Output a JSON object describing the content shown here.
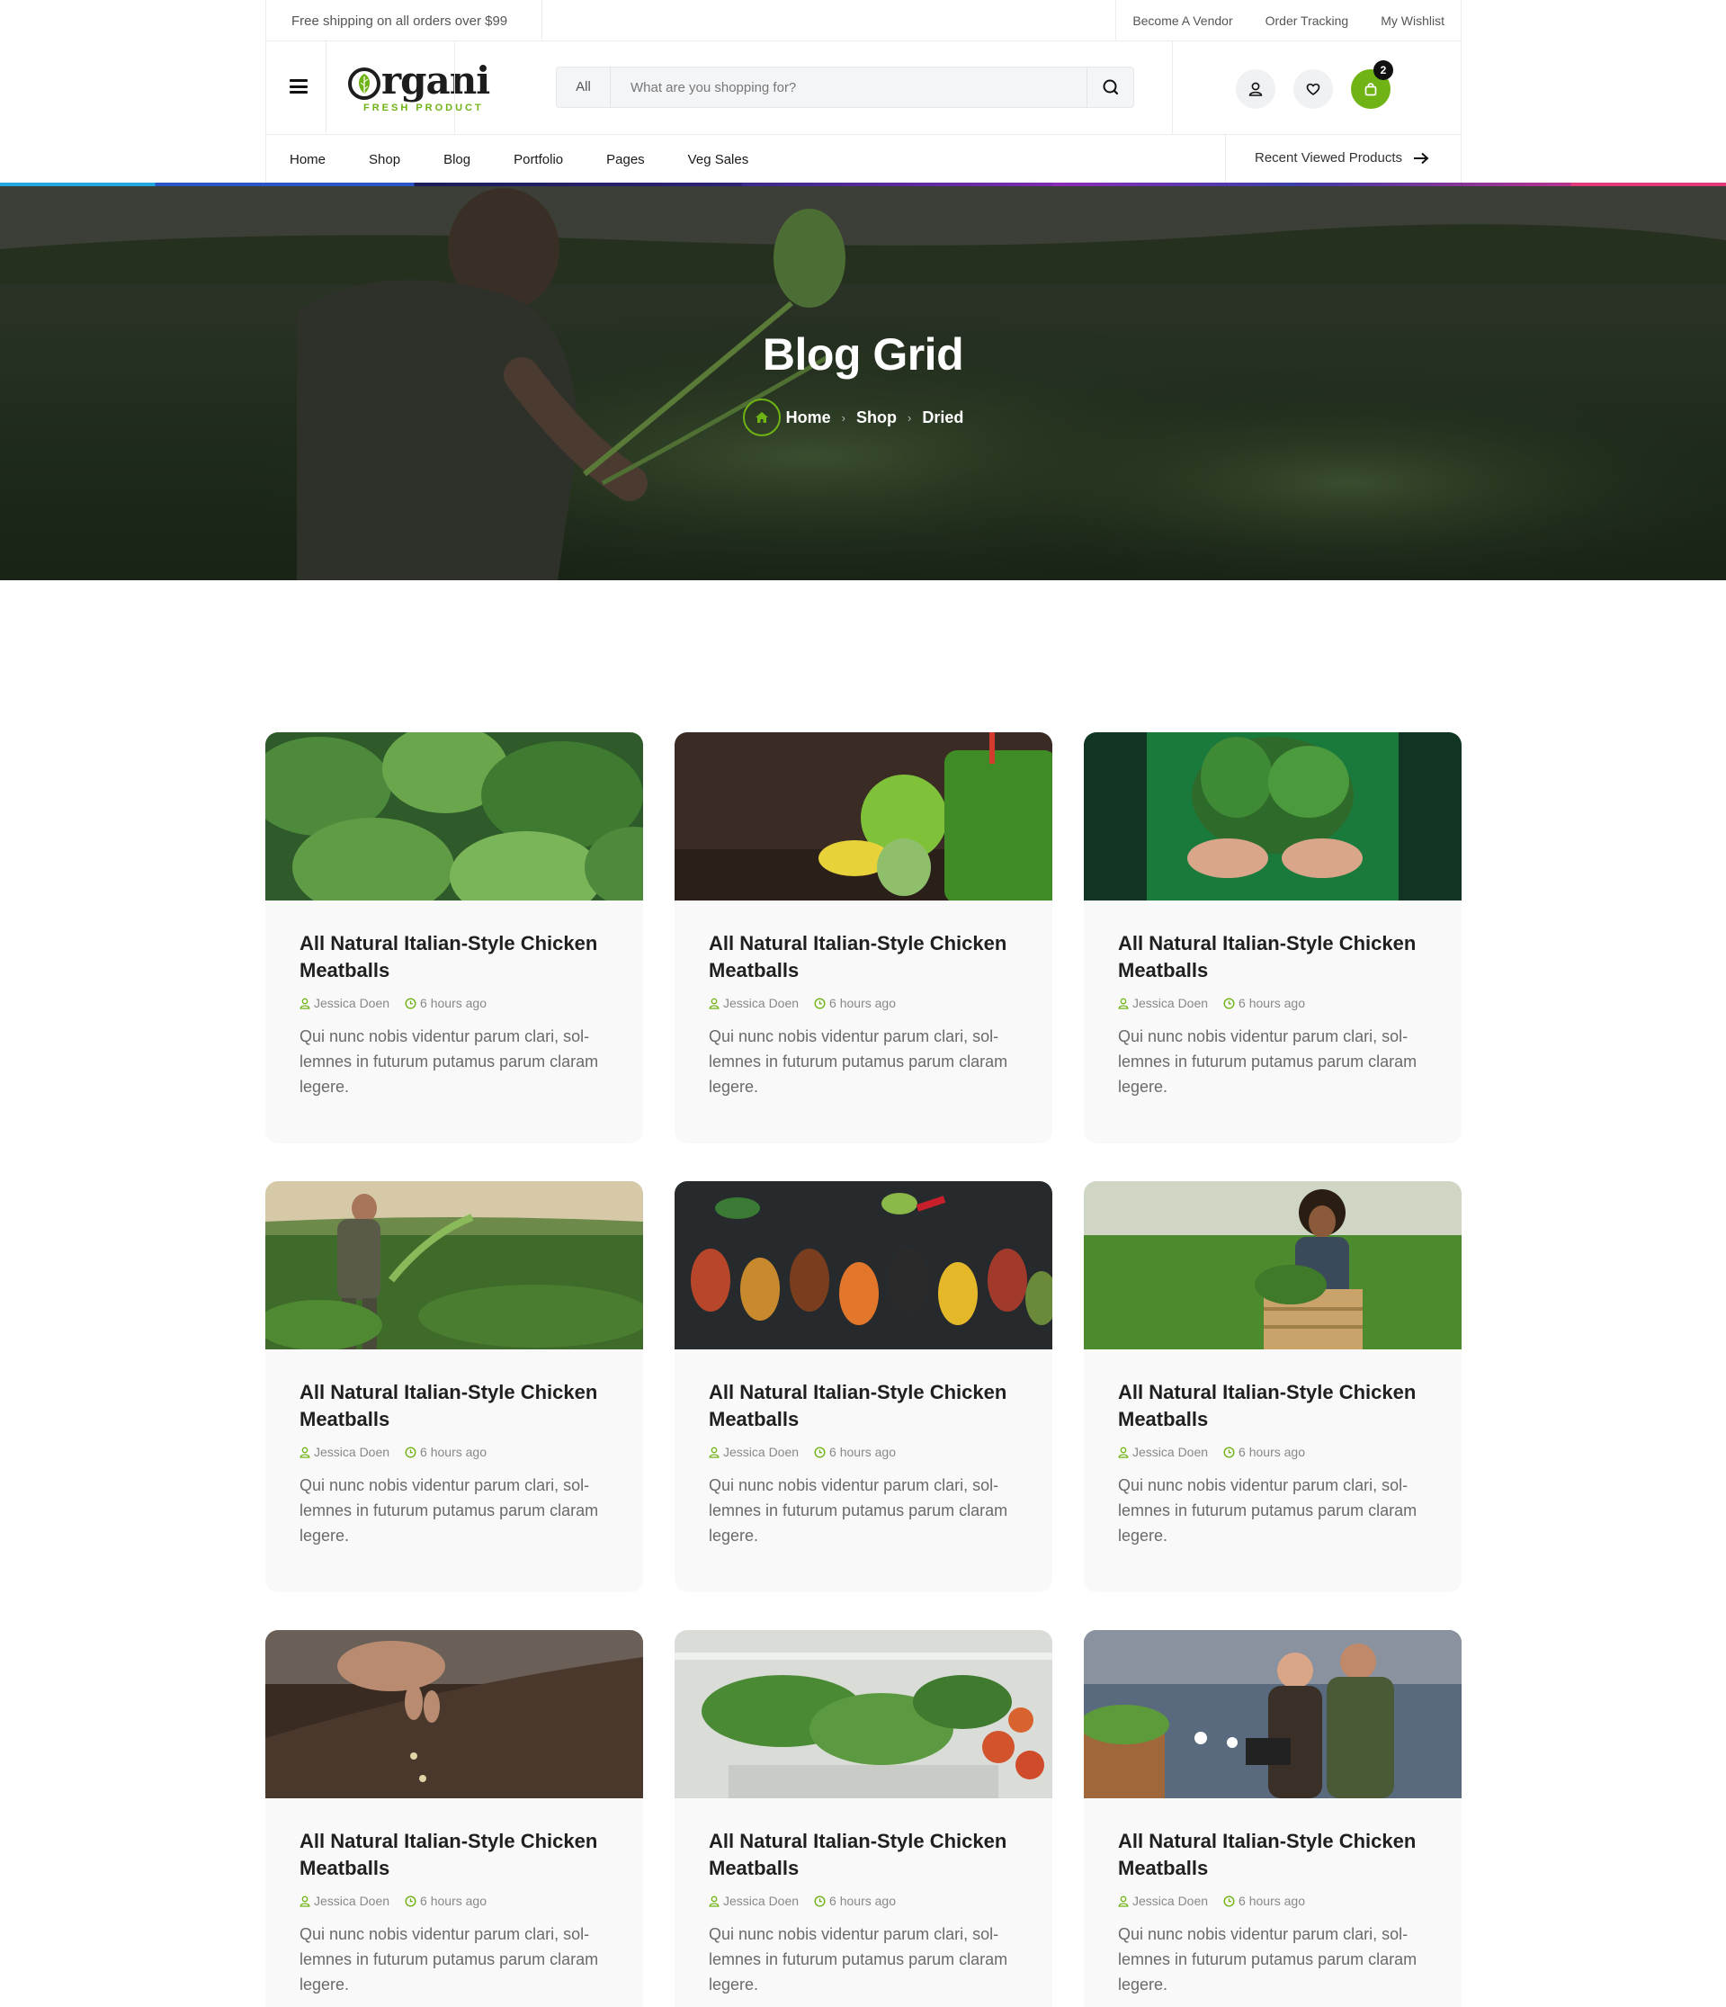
{
  "topbar": {
    "shipping": "Free shipping on all orders over $99",
    "links": [
      "Become A Vendor",
      "Order Tracking",
      "My Wishlist"
    ]
  },
  "header": {
    "logo_text": "rgani",
    "logo_tagline": "FRESH PRODUCT",
    "search_category": "All",
    "search_placeholder": "What are you shopping for?",
    "cart_count": "2",
    "accent_color": "#6fb315"
  },
  "nav": {
    "items": [
      "Home",
      "Shop",
      "Blog",
      "Portfolio",
      "Pages",
      "Veg Sales"
    ],
    "recent": "Recent Viewed Products"
  },
  "hero": {
    "title": "Blog Grid",
    "breadcrumb": [
      "Home",
      "Shop",
      "Dried"
    ]
  },
  "posts": [
    {
      "title": "All Natural Italian-Style Chicken Meatballs",
      "author": "Jessica Doen",
      "time": "6 hours ago",
      "excerpt": "Qui nunc nobis videntur parum clari, sol- lemnes in futurum  putamus parum claram legere.",
      "image": "mint-leaves"
    },
    {
      "title": "All Natural Italian-Style Chicken Meatballs",
      "author": "Jessica Doen",
      "time": "6 hours ago",
      "excerpt": "Qui nunc nobis videntur parum clari, sol- lemnes in futurum  putamus parum claram legere.",
      "image": "green-smoothie"
    },
    {
      "title": "All Natural Italian-Style Chicken Meatballs",
      "author": "Jessica Doen",
      "time": "6 hours ago",
      "excerpt": "Qui nunc nobis videntur parum clari, sol- lemnes in futurum  putamus parum claram legere.",
      "image": "spinach-bunch"
    },
    {
      "title": "All Natural Italian-Style Chicken Meatballs",
      "author": "Jessica Doen",
      "time": "6 hours ago",
      "excerpt": "Qui nunc nobis videntur parum clari, sol- lemnes in futurum  putamus parum claram legere.",
      "image": "farmer-field"
    },
    {
      "title": "All Natural Italian-Style Chicken Meatballs",
      "author": "Jessica Doen",
      "time": "6 hours ago",
      "excerpt": "Qui nunc nobis videntur parum clari, sol- lemnes in futurum  putamus parum claram legere.",
      "image": "spices"
    },
    {
      "title": "All Natural Italian-Style Chicken Meatballs",
      "author": "Jessica Doen",
      "time": "6 hours ago",
      "excerpt": "Qui nunc nobis videntur parum clari, sol- lemnes in futurum  putamus parum claram legere.",
      "image": "woman-crate"
    },
    {
      "title": "All Natural Italian-Style Chicken Meatballs",
      "author": "Jessica Doen",
      "time": "6 hours ago",
      "excerpt": "Qui nunc nobis videntur parum clari, sol- lemnes in futurum  putamus parum claram legere.",
      "image": "soil-seeds"
    },
    {
      "title": "All Natural Italian-Style Chicken Meatballs",
      "author": "Jessica Doen",
      "time": "6 hours ago",
      "excerpt": "Qui nunc nobis videntur parum clari, sol- lemnes in futurum  putamus parum claram legere.",
      "image": "grocery-shelf"
    },
    {
      "title": "All Natural Italian-Style Chicken Meatballs",
      "author": "Jessica Doen",
      "time": "6 hours ago",
      "excerpt": "Qui nunc nobis videntur parum clari, sol- lemnes in futurum  putamus parum claram legere.",
      "image": "warehouse-workers"
    }
  ]
}
